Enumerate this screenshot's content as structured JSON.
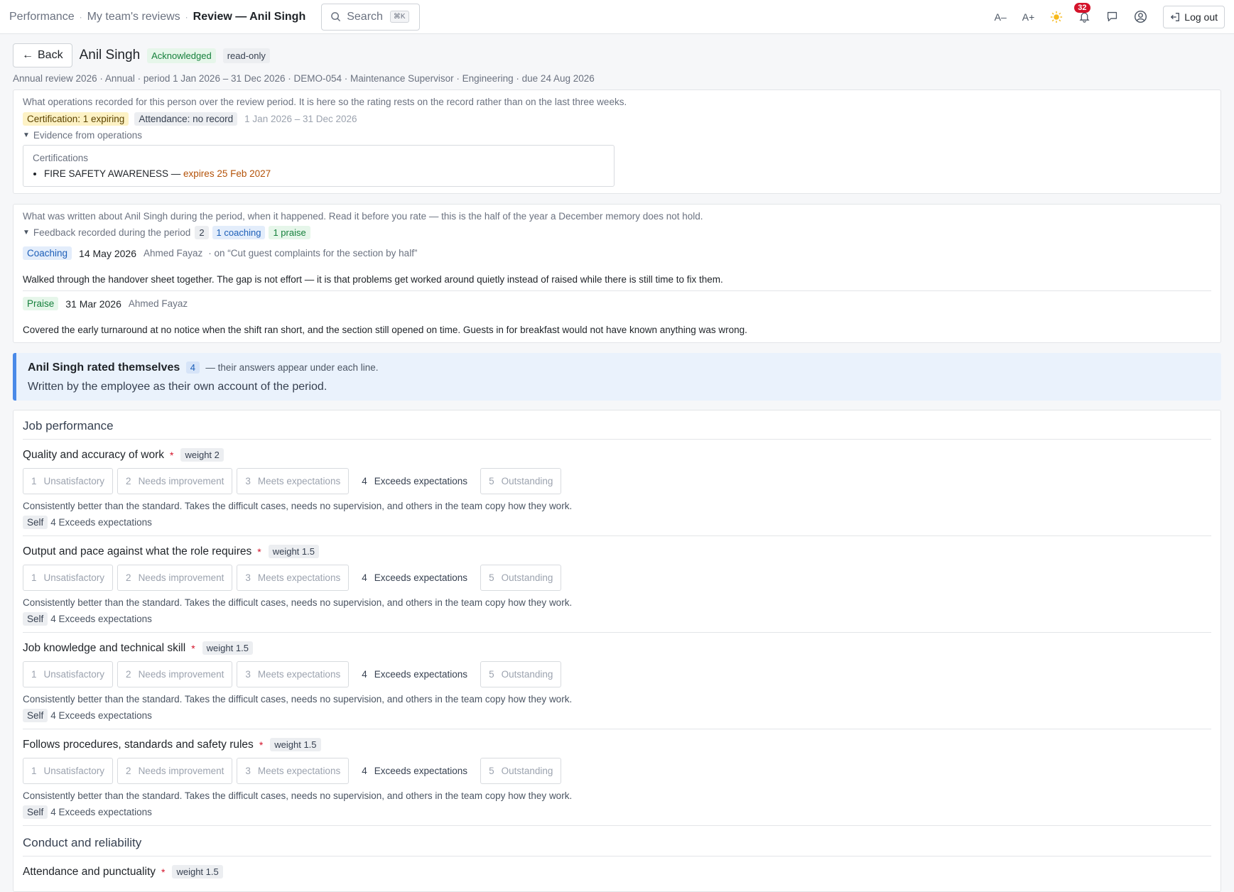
{
  "breadcrumb": {
    "items": [
      "Performance",
      "My team's reviews"
    ],
    "current": "Review — Anil Singh"
  },
  "search": {
    "label": "Search",
    "shortcut": "⌘K"
  },
  "toolbar": {
    "font_decrease": "A–",
    "font_increase": "A+",
    "notifications_count": "32",
    "logout_label": "Log out"
  },
  "header": {
    "back_label": "Back",
    "person_name": "Anil Singh",
    "status_badge": "Acknowledged",
    "mode_badge": "read-only",
    "subline": "Annual review 2026 · Annual · period 1 Jan 2026 – 31 Dec 2026 · DEMO-054 · Maintenance Supervisor · Engineering · due 24 Aug 2026"
  },
  "operations": {
    "intro": "What operations recorded for this person over the review period. It is here so the rating rests on the record rather than on the last three weeks.",
    "cert_chip": "Certification: 1 expiring",
    "attendance_chip": "Attendance: no record",
    "period": "1 Jan 2026 – 31 Dec 2026",
    "toggle_label": "Evidence from operations",
    "evidence": {
      "heading": "Certifications",
      "item_name": "FIRE SAFETY AWARENESS — ",
      "item_expiry": "expires 25 Feb 2027"
    }
  },
  "feedback": {
    "intro": "What was written about Anil Singh during the period, when it happened. Read it before you rate — this is the half of the year a December memory does not hold.",
    "toggle_label": "Feedback recorded during the period",
    "count": "2",
    "coaching_count": "1 coaching",
    "praise_count": "1 praise",
    "items": [
      {
        "type": "Coaching",
        "date": "14 May 2026",
        "author": "Ahmed Fayaz",
        "goal": "· on “Cut guest complaints for the section by half”",
        "text": "Walked through the handover sheet together. The gap is not effort — it is that problems get worked around quietly instead of raised while there is still time to fix them."
      },
      {
        "type": "Praise",
        "date": "31 Mar 2026",
        "author": "Ahmed Fayaz",
        "goal": "",
        "text": "Covered the early turnaround at no notice when the shift ran short, and the section still opened on time. Guests in for breakfast would not have known anything was wrong."
      }
    ]
  },
  "self_rating": {
    "title": "Anil Singh rated themselves",
    "count": "4",
    "note": "— their answers appear under each line.",
    "description": "Written by the employee as their own account of the period."
  },
  "scale_options": [
    {
      "num": "1",
      "label": "Unsatisfactory"
    },
    {
      "num": "2",
      "label": "Needs improvement"
    },
    {
      "num": "3",
      "label": "Meets expectations"
    },
    {
      "num": "4",
      "label": "Exceeds expectations"
    },
    {
      "num": "5",
      "label": "Outstanding"
    }
  ],
  "sections": [
    {
      "title": "Job performance",
      "questions": [
        {
          "title": "Quality and accuracy of work",
          "required": "*",
          "weight": "weight 2",
          "description": "Consistently better than the standard. Takes the difficult cases, needs no supervision, and others in the team copy how they work.",
          "self_label": "Self",
          "self_value": "4 Exceeds expectations"
        },
        {
          "title": "Output and pace against what the role requires",
          "required": "*",
          "weight": "weight 1.5",
          "description": "Consistently better than the standard. Takes the difficult cases, needs no supervision, and others in the team copy how they work.",
          "self_label": "Self",
          "self_value": "4 Exceeds expectations"
        },
        {
          "title": "Job knowledge and technical skill",
          "required": "*",
          "weight": "weight 1.5",
          "description": "Consistently better than the standard. Takes the difficult cases, needs no supervision, and others in the team copy how they work.",
          "self_label": "Self",
          "self_value": "4 Exceeds expectations"
        },
        {
          "title": "Follows procedures, standards and safety rules",
          "required": "*",
          "weight": "weight 1.5",
          "description": "Consistently better than the standard. Takes the difficult cases, needs no supervision, and others in the team copy how they work.",
          "self_label": "Self",
          "self_value": "4 Exceeds expectations"
        }
      ]
    },
    {
      "title": "Conduct and reliability",
      "questions": [
        {
          "title": "Attendance and punctuality",
          "required": "*",
          "weight": "weight 1.5"
        }
      ]
    }
  ]
}
